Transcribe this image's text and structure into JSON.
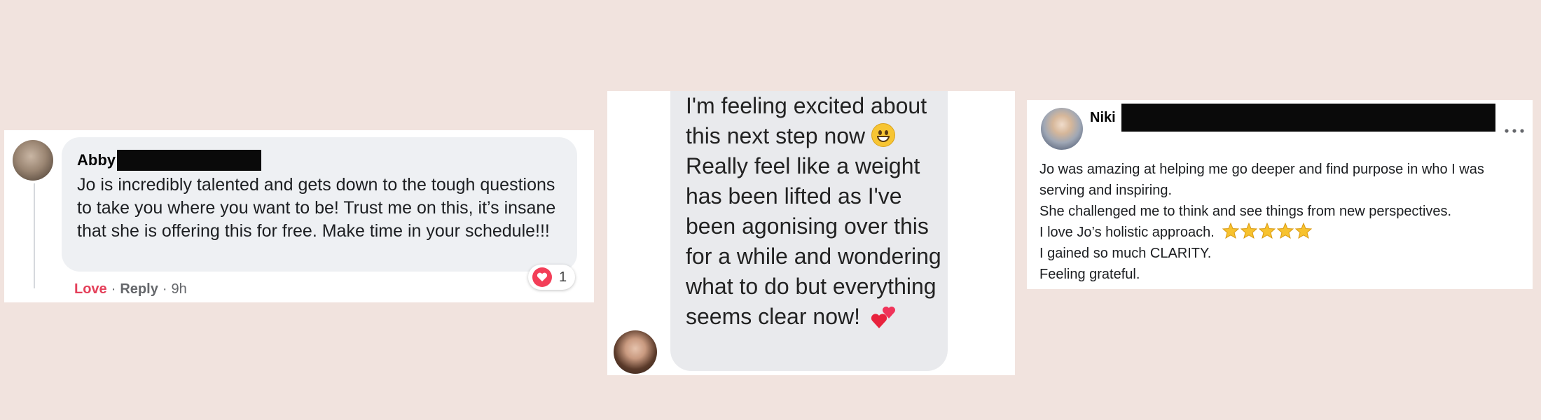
{
  "comment_abby": {
    "name": "Abby",
    "text": "Jo is incredibly talented and gets down to the tough questions to take you where you want to be! Trust me on this, it’s insane that she is offering this for free. Make time in your schedule!!!",
    "reaction_count": "1",
    "actions": {
      "love": "Love",
      "separator": "·",
      "reply": "Reply",
      "time": "9h"
    },
    "colors": {
      "love": "#e4405a",
      "bubble": "#eef0f3"
    }
  },
  "message": {
    "text": "I'm feeling  excited about this next step now",
    "text_2": "Really feel like a weight has been lifted as I've been agonising over this for a while and wondering what to do but everything seems clear now!",
    "emoji_1": "grinning-face-icon",
    "emoji_2": "two-hearts-icon",
    "colors": {
      "bubble": "#e9eaed"
    }
  },
  "comment_niki": {
    "name": "Niki",
    "lines": [
      "Jo was amazing at helping me go deeper and find purpose in who I was serving and inspiring.",
      "She challenged me to think and see things from new perspectives.",
      "I love Jo’s holistic approach.",
      "I gained so much CLARITY.",
      "Feeling grateful."
    ],
    "star_rating": 5,
    "colors": {
      "star": "#f7c22e"
    }
  },
  "page": {
    "background": "#f1e3de"
  }
}
